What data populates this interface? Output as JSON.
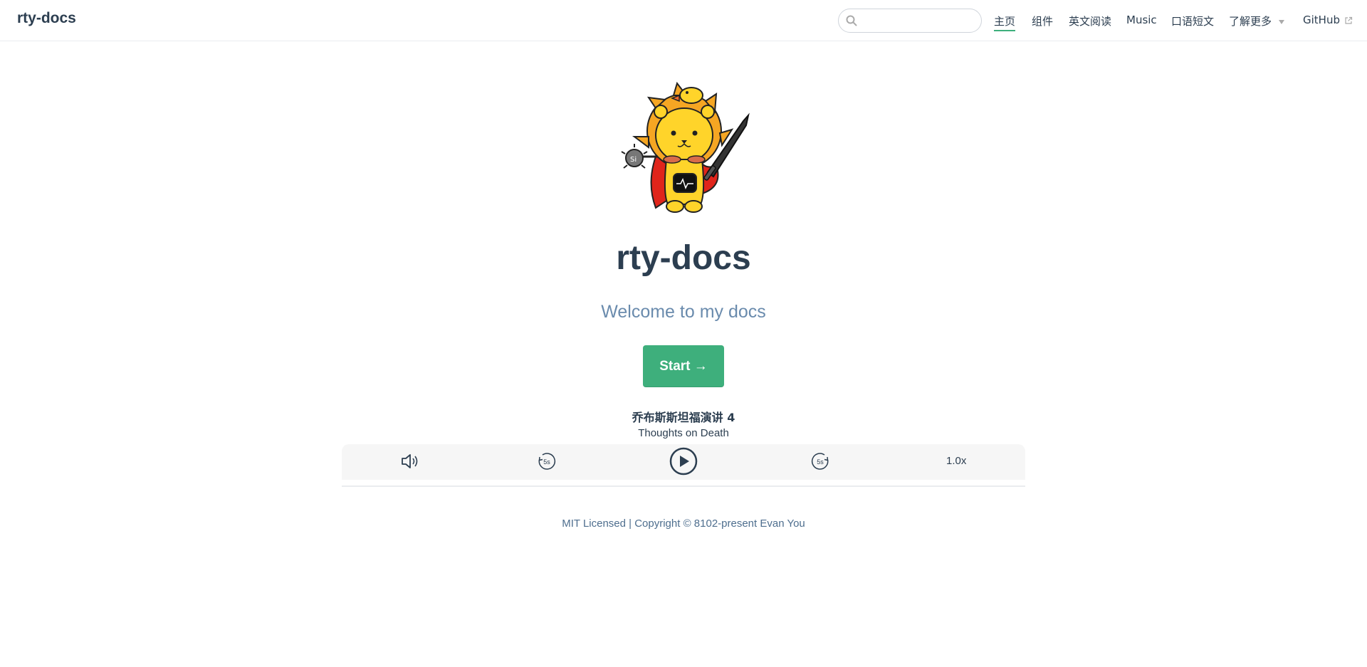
{
  "site": {
    "name": "rty-docs"
  },
  "search": {
    "value": "",
    "placeholder": ""
  },
  "nav": {
    "home": "主页",
    "components": "组件",
    "english_reading": "英文阅读",
    "music": "Music",
    "spoken_essays": "口语短文",
    "learn_more": "了解更多",
    "github": "GitHub"
  },
  "hero": {
    "title": "rty-docs",
    "description": "Welcome to my docs",
    "action_label": "Start →"
  },
  "player": {
    "track_title": "乔布斯斯坦福演讲 4",
    "track_subtitle": "Thoughts on Death",
    "rewind_label": "5s",
    "forward_label": "5s",
    "speed": "1.0x"
  },
  "footer": {
    "text": "MIT Licensed | Copyright © 8102-present Evan You"
  },
  "colors": {
    "accent": "#3eaf7c",
    "text": "#2c3e50",
    "muted": "#6a8bad",
    "mascot_yellow": "#ffd42a",
    "mascot_mane": "#f5a623",
    "cape_red": "#e0251b"
  },
  "icons": {
    "search": "search-icon",
    "volume": "volume-icon",
    "rewind": "rewind-5s-icon",
    "play": "play-icon",
    "forward": "forward-5s-icon",
    "external": "external-link-icon"
  }
}
